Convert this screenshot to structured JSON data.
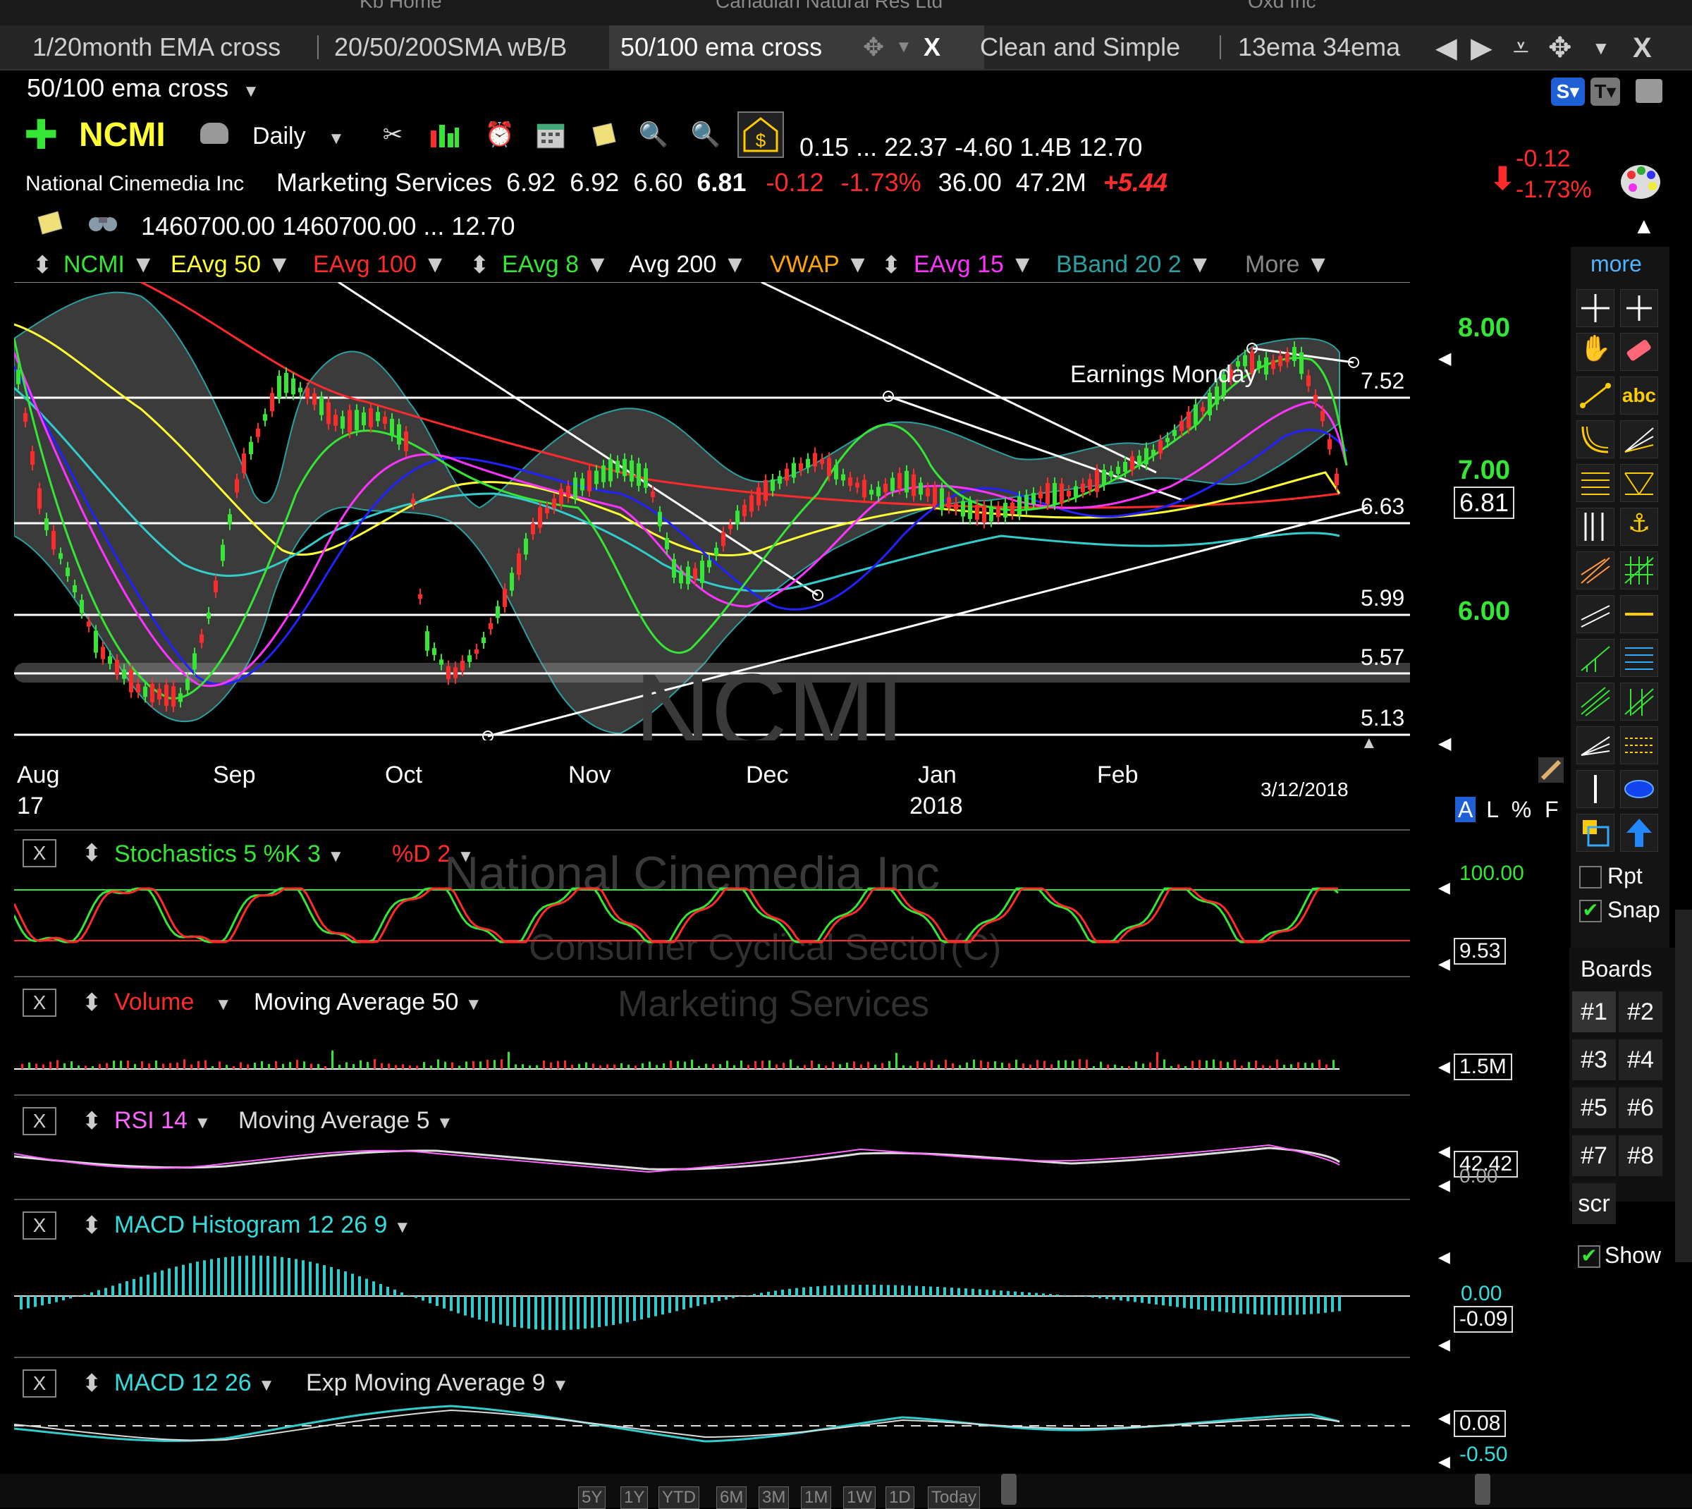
{
  "top_strip": [
    "Kb Home",
    "Canadian Natural Res Ltd",
    "Oxd Inc"
  ],
  "tabs": [
    {
      "label": "1/20month EMA cross"
    },
    {
      "label": "20/50/200SMA wB/B"
    },
    {
      "label": "50/100 ema cross",
      "active": true
    },
    {
      "label": "Clean and Simple"
    },
    {
      "label": "13ema 34ema"
    }
  ],
  "tab_close": "X",
  "window_close": "X",
  "layout_name": "50/100 ema cross",
  "toolbar": {
    "symbol": "NCMI",
    "interval": "Daily",
    "stats1": "0.15  ...  22.37  -4.60  1.4B  12.70"
  },
  "quote": {
    "company": "National Cinemedia Inc",
    "industry": "Marketing Services",
    "open": "6.92",
    "high": "6.92",
    "low": "6.60",
    "last": "6.81",
    "change": "-0.12",
    "change_pct": "-1.73%",
    "pe": "36.00",
    "volume": "47.2M",
    "extra": "+5.44",
    "line3": "1460700.00  1460700.00  ...  12.70",
    "side_change": "-0.12",
    "side_change_pct": "-1.73%"
  },
  "legend": {
    "symbol": "NCMI",
    "items": [
      "EAvg 50",
      "EAvg 100",
      "EAvg 8",
      "Avg 200",
      "VWAP",
      "EAvg 15",
      "BBand 20 2",
      "More"
    ]
  },
  "colors": {
    "ema50": "#ffff33",
    "ema100": "#ff2a2a",
    "ema8": "#35e635",
    "avg200": "#ffffff",
    "vwap": "#ffa500",
    "ema15": "#ff33ff",
    "bband": "#2aa0a0",
    "up": "#35e635",
    "down": "#ff2a2a"
  },
  "price_chart": {
    "y_axis": [
      "8.00",
      "7.00",
      "6.00"
    ],
    "current_price": "6.81",
    "levels": [
      "7.52",
      "6.63",
      "5.99",
      "5.57",
      "5.13"
    ],
    "annotation": "Earnings Monday",
    "watermark": "NCMI",
    "x_axis": [
      "Aug",
      "17",
      "Sep",
      "Oct",
      "Nov",
      "Dec",
      "Jan",
      "2018",
      "Feb"
    ],
    "date": "3/12/2018",
    "scale_modes": [
      "A",
      "L",
      "%",
      "F"
    ]
  },
  "stochastics": {
    "title": "Stochastics 5 %K 3",
    "d": "%D 2",
    "axis": "100.00",
    "value": "9.53",
    "watermark_line1": "National Cinemedia Inc",
    "watermark_line2": "Consumer Cyclical Sector(C)"
  },
  "volume": {
    "title": "Volume",
    "ma": "Moving Average 50",
    "value": "1.5M",
    "watermark": "Marketing Services"
  },
  "rsi": {
    "title": "RSI 14",
    "ma": "Moving Average 5",
    "value": "42.42",
    "axis": "0.00"
  },
  "macd_hist": {
    "title": "MACD Histogram 12 26 9",
    "axis": "0.00",
    "value": "-0.09"
  },
  "macd": {
    "title": "MACD 12 26",
    "ma": "Exp Moving Average 9",
    "value": "0.08",
    "axis": "-0.50"
  },
  "right_panel": {
    "more": "more",
    "abc": "abc",
    "rpt": "Rpt",
    "snap": "Snap",
    "boards_title": "Boards",
    "boards": [
      "#1",
      "#2",
      "#3",
      "#4",
      "#5",
      "#6",
      "#7",
      "#8"
    ],
    "scr": "scr",
    "show": "Show"
  },
  "ranges": [
    "5Y",
    "1Y",
    "YTD",
    "6M",
    "3M",
    "1M",
    "1W",
    "1D",
    "Today"
  ]
}
